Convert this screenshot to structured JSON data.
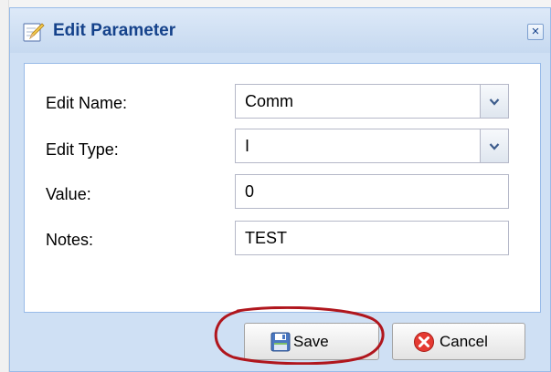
{
  "dialog": {
    "title": "Edit Parameter",
    "close_symbol": "×"
  },
  "form": {
    "name": {
      "label": "Edit Name:",
      "value": "Comm"
    },
    "type": {
      "label": "Edit Type:",
      "value": "I"
    },
    "value": {
      "label": "Value:",
      "value": "0"
    },
    "notes": {
      "label": "Notes:",
      "value": "TEST"
    }
  },
  "buttons": {
    "save_label": "Save",
    "cancel_label": "Cancel"
  },
  "icons": {
    "title": "edit-pencil-icon",
    "save": "floppy-disk-icon",
    "cancel": "red-x-circle-icon",
    "dropdown": "chevron-down-icon",
    "close": "close-icon"
  },
  "colors": {
    "title_text": "#15428b",
    "dialog_border": "#99bbe8",
    "highlight": "#b0161d"
  }
}
